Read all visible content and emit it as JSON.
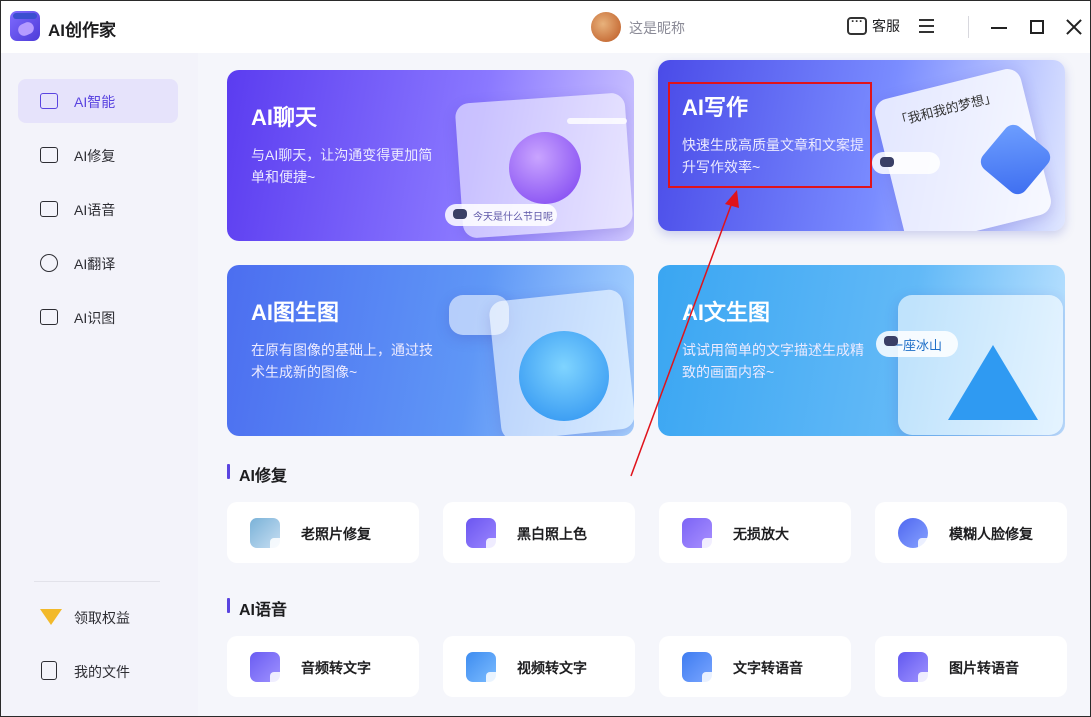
{
  "app": {
    "title": "AI创作家"
  },
  "header": {
    "nickname": "这是昵称",
    "service_label": "客服"
  },
  "sidebar": {
    "items": [
      {
        "label": "AI智能",
        "icon": "ai-smart-icon",
        "active": true
      },
      {
        "label": "AI修复",
        "icon": "repair-icon"
      },
      {
        "label": "AI语音",
        "icon": "voice-icon"
      },
      {
        "label": "AI翻译",
        "icon": "translate-icon"
      },
      {
        "label": "AI识图",
        "icon": "image-recognition-icon"
      }
    ],
    "bottom": [
      {
        "label": "领取权益",
        "icon": "benefit-icon"
      },
      {
        "label": "我的文件",
        "icon": "file-icon"
      }
    ]
  },
  "cards": {
    "chat": {
      "title": "AI聊天",
      "desc": "与AI聊天，让沟通变得更加简单和便捷~",
      "bubble_text": "今天是什么节日呢"
    },
    "write": {
      "title": "AI写作",
      "desc": "快速生成高质量文章和文案提升写作效率~",
      "paper_text": "「我和我的梦想」"
    },
    "img2img": {
      "title": "AI图生图",
      "desc": "在原有图像的基础上，通过技术生成新的图像~"
    },
    "txt2img": {
      "title": "AI文生图",
      "desc": "试试用简单的文字描述生成精致的画面内容~",
      "tag_text": "一座冰山"
    }
  },
  "sections": {
    "repair": {
      "title": "AI修复",
      "tools": [
        "老照片修复",
        "黑白照上色",
        "无损放大",
        "模糊人脸修复"
      ]
    },
    "voice": {
      "title": "AI语音",
      "tools": [
        "音频转文字",
        "视频转文字",
        "文字转语音",
        "图片转语音"
      ]
    }
  },
  "colors": {
    "accent": "#5a44e0",
    "highlight_box": "#e0131b"
  }
}
